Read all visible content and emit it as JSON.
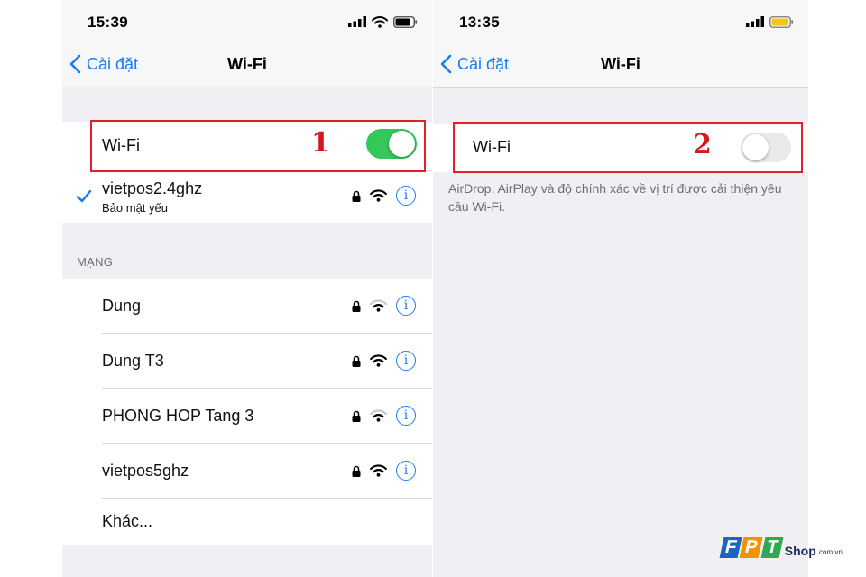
{
  "left": {
    "status_time": "15:39",
    "back_label": "Cài đặt",
    "title": "Wi-Fi",
    "wifi_toggle_label": "Wi-Fi",
    "wifi_on": true,
    "marker": "1",
    "connected": {
      "name": "vietpos2.4ghz",
      "subtitle": "Bảo mật yếu"
    },
    "section_header": "MẠNG",
    "networks": [
      {
        "name": "Dung",
        "signal": 2
      },
      {
        "name": "Dung T3",
        "signal": 3
      },
      {
        "name": "PHONG HOP Tang 3",
        "signal": 2
      },
      {
        "name": "vietpos5ghz",
        "signal": 3
      }
    ],
    "other_label": "Khác..."
  },
  "right": {
    "status_time": "13:35",
    "back_label": "Cài đặt",
    "title": "Wi-Fi",
    "wifi_toggle_label": "Wi-Fi",
    "wifi_on": false,
    "marker": "2",
    "footnote": "AirDrop, AirPlay và độ chính xác về vị trí được cải thiện yêu cầu Wi-Fi."
  },
  "watermark": {
    "letters": [
      "F",
      "P",
      "T"
    ],
    "shop": "Shop",
    "domain": ".com.vn"
  },
  "colors": {
    "accent": "#1a7cf5",
    "toggle_on": "#34c759",
    "toggle_off": "#e9e9eb",
    "highlight": "#e2202c",
    "battery_low": "#f5c518"
  }
}
